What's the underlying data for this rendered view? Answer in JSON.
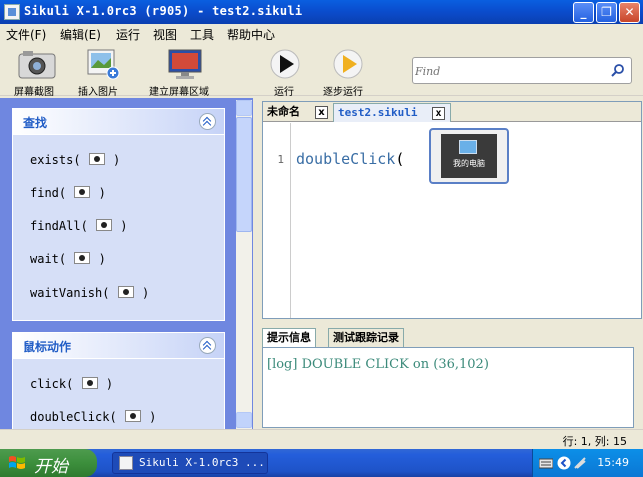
{
  "window": {
    "title": "Sikuli X-1.0rc3 (r905) - test2.sikuli",
    "minimize_label": "_",
    "maximize_label": "❐",
    "close_label": "✕"
  },
  "menu": [
    "文件(F)",
    "编辑(E)",
    "运行",
    "视图",
    "工具",
    "帮助中心"
  ],
  "toolbar": {
    "screenshot_label": "屏幕截图",
    "insert_image_label": "插入图片",
    "region_label": "建立屏幕区域",
    "run_label": "运行",
    "step_label": "逐步运行",
    "find_placeholder": "Find"
  },
  "sidebar": {
    "groups": [
      {
        "title": "查找",
        "commands": [
          {
            "name": "exists(",
            "suffix": ")"
          },
          {
            "name": "find(",
            "suffix": ")"
          },
          {
            "name": "findAll(",
            "suffix": ")"
          },
          {
            "name": "wait(",
            "suffix": ")"
          },
          {
            "name": "waitVanish(",
            "suffix": ")"
          }
        ]
      },
      {
        "title": "鼠标动作",
        "commands": [
          {
            "name": "click(",
            "suffix": ")"
          },
          {
            "name": "doubleClick(",
            "suffix": ")"
          }
        ]
      }
    ]
  },
  "editor": {
    "tabs": [
      {
        "label": "未命名",
        "active": false
      },
      {
        "label": "test2.sikuli",
        "active": true
      }
    ],
    "tab_close_glyph": "x",
    "line_number": "1",
    "code_func": "doubleClick",
    "code_open": "(",
    "code_close": ")",
    "image_caption": "我的电脑"
  },
  "console": {
    "tabs": [
      "提示信息",
      "测试跟踪记录"
    ],
    "log": "[log] DOUBLE CLICK on (36,102)"
  },
  "status": {
    "position": "行: 1, 列: 15"
  },
  "taskbar": {
    "start_label": "开始",
    "task_label": "Sikuli X-1.0rc3 ...",
    "clock": "15:49"
  },
  "colors": {
    "accent": "#215dc6",
    "code": "#3a6ea5",
    "log": "#3b8a7a",
    "sidebar_bg": "#6f87e0"
  }
}
